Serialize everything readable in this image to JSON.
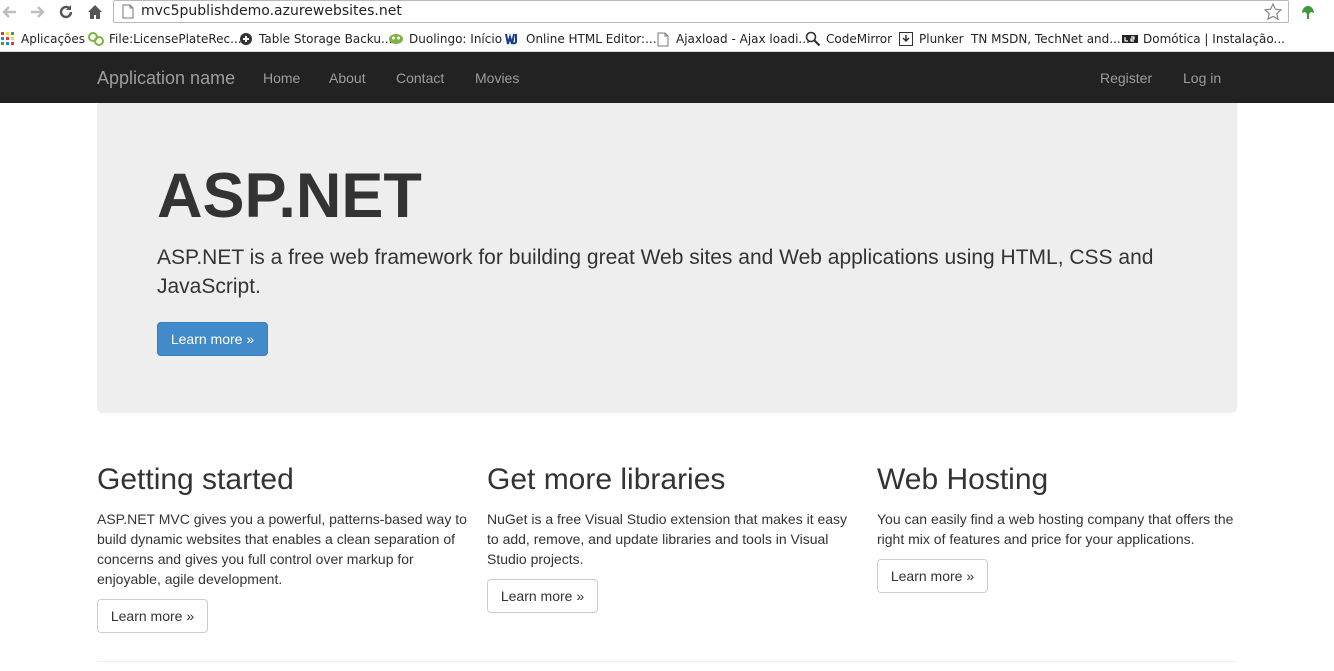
{
  "browser": {
    "url": "mvc5publishdemo.azurewebsites.net",
    "bookmarks": [
      {
        "label": "Aplicações",
        "icon": "apps-grid-icon"
      },
      {
        "label": "File:LicensePlateRec...",
        "icon": "wiki-icon"
      },
      {
        "label": "Table Storage Backu...",
        "icon": "storage-icon"
      },
      {
        "label": "Duolingo: Início",
        "icon": "duolingo-icon"
      },
      {
        "label": "Online HTML Editor:...",
        "icon": "editor-icon"
      },
      {
        "label": "Ajaxload - Ajax loadi...",
        "icon": "page-icon"
      },
      {
        "label": "CodeMirror",
        "icon": "magnifier-icon"
      },
      {
        "label": "Plunker",
        "icon": "download-icon"
      },
      {
        "label": "TN  MSDN, TechNet and...",
        "icon": "technet-icon"
      },
      {
        "label": "Domótica | Instalação...",
        "icon": "ls-icon"
      }
    ]
  },
  "navbar": {
    "brand": "Application name",
    "links": [
      "Home",
      "About",
      "Contact",
      "Movies"
    ],
    "right_links": [
      "Register",
      "Log in"
    ]
  },
  "jumbotron": {
    "title": "ASP.NET",
    "lead": "ASP.NET is a free web framework for building great Web sites and Web applications using HTML, CSS and JavaScript.",
    "button": "Learn more »"
  },
  "columns": [
    {
      "title": "Getting started",
      "text": "ASP.NET MVC gives you a powerful, patterns-based way to build dynamic websites that enables a clean separation of concerns and gives you full control over markup for enjoyable, agile development.",
      "button": "Learn more »"
    },
    {
      "title": "Get more libraries",
      "text": "NuGet is a free Visual Studio extension that makes it easy to add, remove, and update libraries and tools in Visual Studio projects.",
      "button": "Learn more »"
    },
    {
      "title": "Web Hosting",
      "text": "You can easily find a web hosting company that offers the right mix of features and price for your applications.",
      "button": "Learn more »"
    }
  ],
  "colors": {
    "navbar_bg": "#222222",
    "nav_text": "#9d9d9d",
    "jumbotron_bg": "#eeeeee",
    "primary": "#428bca"
  }
}
